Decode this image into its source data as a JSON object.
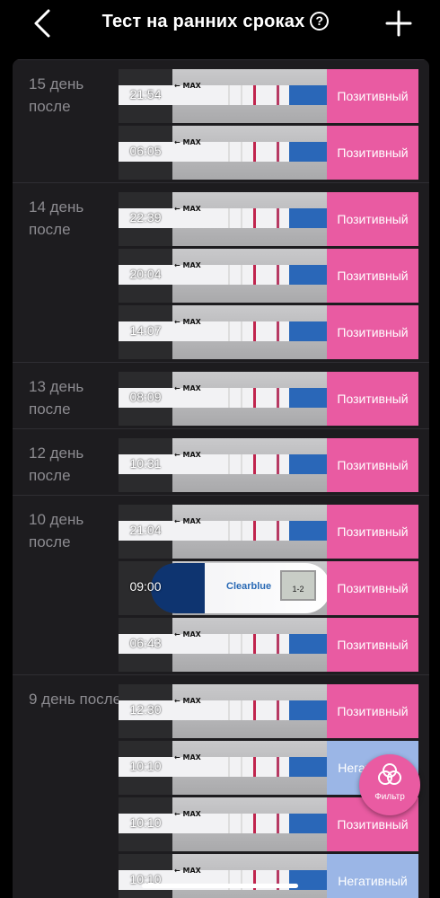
{
  "header": {
    "title": "Тест на ранних сроках",
    "help": "?"
  },
  "groups": [
    {
      "day": "15 день после",
      "entries": [
        {
          "time": "21:54",
          "result": "Позитивный",
          "kind": "pos"
        },
        {
          "time": "06:05",
          "result": "Позитивный",
          "kind": "pos"
        }
      ]
    },
    {
      "day": "14 день после",
      "entries": [
        {
          "time": "22:39",
          "result": "Позитивный",
          "kind": "pos"
        },
        {
          "time": "20:04",
          "result": "Позитивный",
          "kind": "pos"
        },
        {
          "time": "14:07",
          "result": "Позитивный",
          "kind": "pos"
        }
      ]
    },
    {
      "day": "13 день после",
      "entries": [
        {
          "time": "08:09",
          "result": "Позитивный",
          "kind": "pos"
        }
      ]
    },
    {
      "day": "12 день после",
      "entries": [
        {
          "time": "10:31",
          "result": "Позитивный",
          "kind": "pos"
        }
      ]
    },
    {
      "day": "10 день после",
      "entries": [
        {
          "time": "21:04",
          "result": "Позитивный",
          "kind": "pos"
        },
        {
          "time": "09:00",
          "result": "Позитивный",
          "kind": "pos",
          "digital": true
        },
        {
          "time": "06:43",
          "result": "Позитивный",
          "kind": "pos"
        }
      ]
    },
    {
      "day": "9 день после",
      "entries": [
        {
          "time": "12:30",
          "result": "Позитивный",
          "kind": "pos"
        },
        {
          "time": "10:10",
          "result": "Негативный",
          "kind": "neg"
        },
        {
          "time": "10:10",
          "result": "Позитивный",
          "kind": "pos"
        },
        {
          "time": "10:10",
          "result": "Негативный",
          "kind": "neg"
        }
      ]
    }
  ],
  "strip_text": {
    "max": "← MAX",
    "brand": "Clearblue",
    "screen": "1-2"
  },
  "filter": {
    "label": "Фильтр"
  },
  "colors": {
    "positive": "#e95ba2",
    "negative": "#9bb6e6",
    "background": "#1d1c1f"
  }
}
